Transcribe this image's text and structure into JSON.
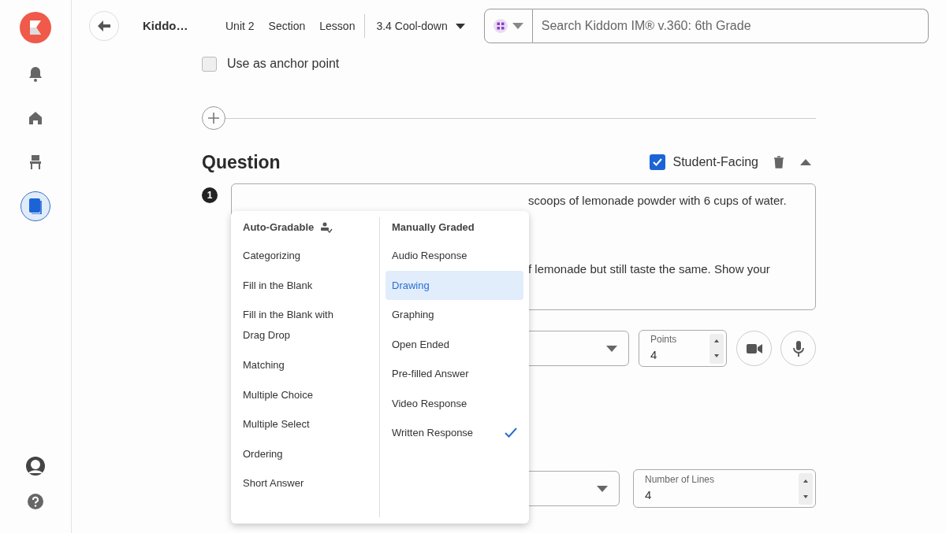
{
  "sidebar": {
    "items": [
      {
        "kind": "bell",
        "selected": false
      },
      {
        "kind": "home",
        "selected": false
      },
      {
        "kind": "chair",
        "selected": false
      },
      {
        "kind": "book",
        "selected": true
      }
    ]
  },
  "header": {
    "title": "Kiddo…",
    "breadcrumbs": [
      "Unit 2",
      "Section",
      "Lesson"
    ],
    "current": "3.4 Cool-down",
    "search": {
      "placeholder": "Search Kiddom IM® v.360: 6th Grade"
    }
  },
  "anchor": {
    "label": "Use as anchor point",
    "checked": false
  },
  "question": {
    "heading": "Question",
    "student_facing": {
      "label": "Student-Facing",
      "checked": true
    },
    "number": "1",
    "prompt_lines": [
      "scoops of lemonade powder with 6 cups of water.",
      "f lemonade but still taste the same. Show your"
    ],
    "points": {
      "label": "Points",
      "value": "4"
    },
    "lines": {
      "label": "Number of Lines",
      "value": "4"
    },
    "type_menu": {
      "columns": [
        {
          "heading": "Auto-Gradable",
          "auto_icon": true,
          "items": [
            {
              "label": "Categorizing",
              "hovered": false,
              "checked": false
            },
            {
              "label": "Fill in the Blank",
              "hovered": false,
              "checked": false
            },
            {
              "label": "Fill in the Blank with Drag Drop",
              "hovered": false,
              "checked": false
            },
            {
              "label": "Matching",
              "hovered": false,
              "checked": false
            },
            {
              "label": "Multiple Choice",
              "hovered": false,
              "checked": false
            },
            {
              "label": "Multiple Select",
              "hovered": false,
              "checked": false
            },
            {
              "label": "Ordering",
              "hovered": false,
              "checked": false
            },
            {
              "label": "Short Answer",
              "hovered": false,
              "checked": false
            }
          ]
        },
        {
          "heading": "Manually Graded",
          "auto_icon": false,
          "items": [
            {
              "label": "Audio Response",
              "hovered": false,
              "checked": false
            },
            {
              "label": "Drawing",
              "hovered": true,
              "checked": false
            },
            {
              "label": "Graphing",
              "hovered": false,
              "checked": false
            },
            {
              "label": "Open Ended",
              "hovered": false,
              "checked": false
            },
            {
              "label": "Pre-filled Answer",
              "hovered": false,
              "checked": false
            },
            {
              "label": "Video Response",
              "hovered": false,
              "checked": false
            },
            {
              "label": "Written Response",
              "hovered": false,
              "checked": true
            }
          ]
        }
      ]
    }
  }
}
